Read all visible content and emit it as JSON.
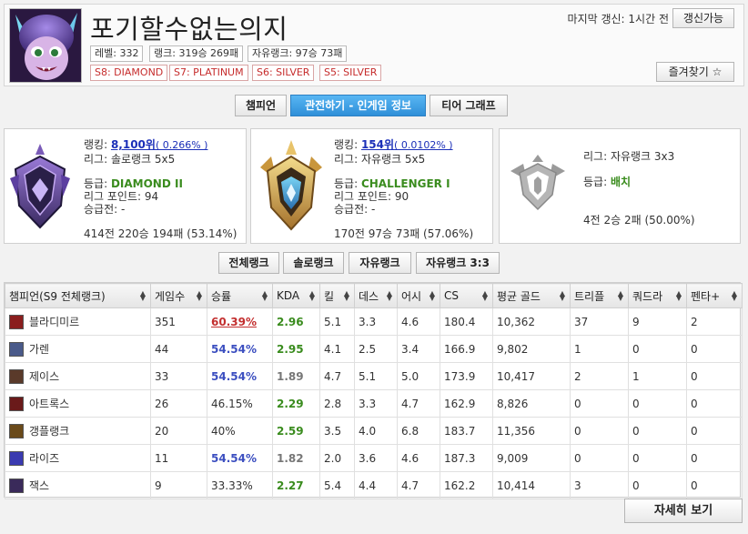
{
  "header": {
    "summoner_name": "포기할수없는의지",
    "level": "레벨: 332",
    "rank_record": "랭크: 319승 269패",
    "flex_record": "자유랭크: 97승 73패",
    "seasons": [
      "S8: DIAMOND",
      "S7: PLATINUM",
      "S6: SILVER",
      "S5: SILVER"
    ],
    "last_updated": "마지막 갱신: 1시간 전",
    "update_label": "갱신가능",
    "favorite_label": "즐겨찾기 ☆"
  },
  "tabs": [
    {
      "label": "챔피언"
    },
    {
      "label": "관전하기 - 인게임 정보"
    },
    {
      "label": "티어 그래프"
    }
  ],
  "cards": {
    "solo": {
      "ranking_label": "랭킹:",
      "ranking_value": "8,100위",
      "ranking_pct": "( 0.266% )",
      "league": "리그: 솔로랭크 5x5",
      "tier_label": "등급:",
      "tier_value": "DIAMOND II",
      "points": "리그 포인트: 94",
      "promo": "승급전: -",
      "record": "414전 220승 194패 (53.14%)"
    },
    "flex": {
      "ranking_label": "랭킹:",
      "ranking_value": "154위",
      "ranking_pct": "( 0.0102% )",
      "league": "리그: 자유랭크 5x5",
      "tier_label": "등급:",
      "tier_value": "CHALLENGER I",
      "points": "리그 포인트: 90",
      "promo": "승급전: -",
      "record": "170전 97승 73패 (57.06%)"
    },
    "tt": {
      "league": "리그: 자유랭크 3x3",
      "tier_label": "등급:",
      "tier_value": "배치",
      "record": "4전 2승 2패 (50.00%)"
    }
  },
  "rank_filters": [
    {
      "label": "전체랭크"
    },
    {
      "label": "솔로랭크"
    },
    {
      "label": "자유랭크"
    },
    {
      "label": "자유랭크 3:3"
    }
  ],
  "table": {
    "columns": [
      "챔피언(S9 전체랭크)",
      "게임수",
      "승률",
      "KDA",
      "킬",
      "데스",
      "어시",
      "CS",
      "평균 골드",
      "트리플",
      "쿼드라",
      "펜타+"
    ],
    "rows": [
      {
        "champ": "블라디미르",
        "games": "351",
        "winrate": "60.39%",
        "kda": "2.96",
        "k": "5.1",
        "d": "3.3",
        "a": "4.6",
        "cs": "180.4",
        "gold": "10,362",
        "triple": "37",
        "quadra": "9",
        "penta": "2"
      },
      {
        "champ": "가렌",
        "games": "44",
        "winrate": "54.54%",
        "kda": "2.95",
        "k": "4.1",
        "d": "2.5",
        "a": "3.4",
        "cs": "166.9",
        "gold": "9,802",
        "triple": "1",
        "quadra": "0",
        "penta": "0"
      },
      {
        "champ": "제이스",
        "games": "33",
        "winrate": "54.54%",
        "kda": "1.89",
        "k": "4.7",
        "d": "5.1",
        "a": "5.0",
        "cs": "173.9",
        "gold": "10,417",
        "triple": "2",
        "quadra": "1",
        "penta": "0"
      },
      {
        "champ": "아트록스",
        "games": "26",
        "winrate": "46.15%",
        "kda": "2.29",
        "k": "2.8",
        "d": "3.3",
        "a": "4.7",
        "cs": "162.9",
        "gold": "8,826",
        "triple": "0",
        "quadra": "0",
        "penta": "0"
      },
      {
        "champ": "갱플랭크",
        "games": "20",
        "winrate": "40%",
        "kda": "2.59",
        "k": "3.5",
        "d": "4.0",
        "a": "6.8",
        "cs": "183.7",
        "gold": "11,356",
        "triple": "0",
        "quadra": "0",
        "penta": "0"
      },
      {
        "champ": "라이즈",
        "games": "11",
        "winrate": "54.54%",
        "kda": "1.82",
        "k": "2.0",
        "d": "3.6",
        "a": "4.6",
        "cs": "187.3",
        "gold": "9,009",
        "triple": "0",
        "quadra": "0",
        "penta": "0"
      },
      {
        "champ": "잭스",
        "games": "9",
        "winrate": "33.33%",
        "kda": "2.27",
        "k": "5.4",
        "d": "4.4",
        "a": "4.7",
        "cs": "162.2",
        "gold": "10,414",
        "triple": "3",
        "quadra": "0",
        "penta": "0"
      }
    ]
  },
  "detail_label": "자세히 보기",
  "colors": {
    "accent_blue": "#2f8fd8",
    "win_high": "#3c4fc0",
    "win_top": "#c32f2f",
    "kda_green": "#3a8c1e",
    "season_red": "#c62c2c"
  }
}
